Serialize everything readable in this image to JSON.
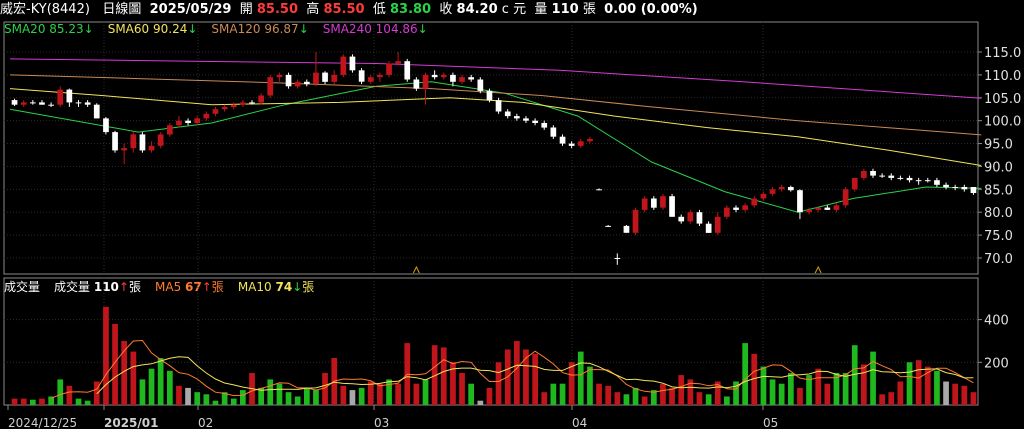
{
  "header": {
    "name": "威宏-KY(8442)",
    "period": "日線圖",
    "date": "2025/05/29",
    "open_label": "開",
    "open": "85.50",
    "high_label": "高",
    "high": "85.50",
    "low_label": "低",
    "low": "83.80",
    "close_label": "收",
    "close": "84.20",
    "close_flag": "c",
    "currency": "元",
    "vol_label": "量",
    "vol": "110",
    "vol_unit": "張",
    "change": "0.00 (0.00%)"
  },
  "price_legend": [
    {
      "label": "SMA20",
      "value": "85.23",
      "arrow": "↓",
      "color": "#29d34a"
    },
    {
      "label": "SMA60",
      "value": "90.24",
      "arrow": "↓",
      "color": "#f2e35a"
    },
    {
      "label": "SMA120",
      "value": "96.87",
      "arrow": "↓",
      "color": "#c98a55"
    },
    {
      "label": "SMA240",
      "value": "104.86",
      "arrow": "↓",
      "color": "#d33bd3"
    }
  ],
  "volume_legend": {
    "title": "成交量",
    "items": [
      {
        "label": "成交量",
        "value": "110",
        "arrow": "↑",
        "unit": "張",
        "label_color": "#ffffff",
        "value_color": "#ffffff",
        "arrow_color": "#ff3b3b"
      },
      {
        "label": "MA5",
        "value": "67",
        "arrow": "↑",
        "unit": "張",
        "label_color": "#ff7b2e",
        "value_color": "#ff7b2e",
        "arrow_color": "#ff3b3b"
      },
      {
        "label": "MA10",
        "value": "74",
        "arrow": "↓",
        "unit": "張",
        "label_color": "#f2e35a",
        "value_color": "#f2e35a",
        "arrow_color": "#29d34a"
      }
    ]
  },
  "colors": {
    "up": "#c0161b",
    "down": "#ffffff",
    "vol_up": "#c0161b",
    "vol_down": "#1fb81f",
    "vol_flat": "#a9a9a9",
    "grid": "#2a2a2a",
    "frame": "#8a8a8a",
    "marker": "#d8a000"
  },
  "chart_data": [
    {
      "type": "candlestick",
      "x_labels": [
        "2024/12/25",
        "2025/01",
        "02",
        "03",
        "04",
        "05"
      ],
      "y_ticks": [
        70.0,
        75.0,
        80.0,
        85.0,
        90.0,
        95.0,
        100.0,
        105.0,
        110.0,
        115.0
      ],
      "ylim": [
        66.5,
        118.5
      ],
      "candles": [
        [
          104.5,
          104.8,
          103.2,
          103.5
        ],
        [
          103.5,
          104.5,
          103.0,
          104.0
        ],
        [
          104.0,
          104.5,
          103.5,
          104.0
        ],
        [
          104.0,
          104.5,
          103.5,
          103.5
        ],
        [
          103.5,
          104.0,
          103.0,
          103.5
        ],
        [
          103.5,
          107.5,
          103.0,
          106.8
        ],
        [
          106.8,
          107.0,
          103.0,
          104.0
        ],
        [
          104.0,
          104.5,
          103.0,
          104.0
        ],
        [
          104.0,
          104.5,
          103.0,
          103.5
        ],
        [
          103.5,
          103.8,
          100.5,
          100.5
        ],
        [
          100.5,
          100.8,
          97.0,
          97.5
        ],
        [
          97.5,
          97.8,
          93.0,
          93.5
        ],
        [
          93.5,
          95.0,
          90.5,
          94.0
        ],
        [
          94.0,
          97.5,
          93.0,
          97.0
        ],
        [
          97.0,
          97.5,
          93.0,
          93.5
        ],
        [
          93.5,
          95.5,
          93.0,
          94.5
        ],
        [
          94.5,
          97.5,
          94.0,
          97.0
        ],
        [
          97.0,
          99.5,
          96.5,
          99.0
        ],
        [
          99.0,
          101.0,
          98.5,
          100.0
        ],
        [
          100.0,
          100.5,
          99.0,
          99.5
        ],
        [
          99.5,
          101.0,
          99.0,
          100.5
        ],
        [
          100.5,
          102.0,
          100.0,
          101.5
        ],
        [
          101.5,
          103.0,
          101.0,
          102.5
        ],
        [
          102.5,
          103.5,
          102.0,
          103.0
        ],
        [
          103.0,
          104.0,
          102.5,
          103.5
        ],
        [
          103.5,
          104.5,
          103.0,
          104.0
        ],
        [
          104.0,
          104.5,
          103.5,
          104.0
        ],
        [
          104.0,
          106.0,
          103.5,
          105.5
        ],
        [
          105.5,
          110.0,
          105.0,
          109.5
        ],
        [
          109.5,
          110.5,
          108.5,
          110.0
        ],
        [
          110.0,
          110.5,
          107.0,
          107.5
        ],
        [
          107.5,
          109.0,
          107.0,
          108.5
        ],
        [
          108.5,
          109.0,
          107.5,
          108.0
        ],
        [
          108.0,
          115.0,
          107.5,
          110.5
        ],
        [
          110.5,
          110.8,
          108.0,
          108.5
        ],
        [
          108.5,
          111.0,
          108.0,
          110.0
        ],
        [
          110.0,
          114.5,
          109.5,
          114.0
        ],
        [
          114.0,
          114.5,
          110.5,
          111.0
        ],
        [
          111.0,
          111.5,
          108.0,
          108.5
        ],
        [
          108.5,
          110.0,
          108.0,
          109.5
        ],
        [
          109.5,
          110.5,
          108.5,
          110.0
        ],
        [
          110.0,
          113.0,
          109.5,
          112.5
        ],
        [
          112.5,
          115.0,
          112.0,
          113.0
        ],
        [
          113.0,
          113.5,
          108.5,
          109.0
        ],
        [
          109.0,
          109.5,
          106.5,
          107.0
        ],
        [
          107.0,
          110.5,
          103.5,
          110.0
        ],
        [
          110.0,
          111.0,
          109.0,
          109.5
        ],
        [
          109.5,
          110.5,
          109.0,
          110.0
        ],
        [
          110.0,
          110.5,
          107.5,
          108.5
        ],
        [
          108.5,
          110.0,
          108.0,
          109.5
        ],
        [
          109.5,
          110.0,
          108.5,
          109.0
        ],
        [
          109.0,
          109.5,
          106.0,
          106.5
        ],
        [
          106.5,
          107.0,
          104.0,
          104.5
        ],
        [
          104.5,
          105.0,
          101.5,
          102.0
        ],
        [
          102.0,
          102.5,
          100.5,
          101.0
        ],
        [
          101.0,
          101.5,
          100.0,
          100.5
        ],
        [
          100.5,
          101.0,
          99.5,
          100.0
        ],
        [
          100.0,
          100.5,
          99.0,
          99.5
        ],
        [
          99.5,
          100.0,
          98.0,
          98.5
        ],
        [
          98.5,
          99.0,
          96.0,
          96.5
        ],
        [
          96.5,
          97.0,
          94.5,
          95.0
        ],
        [
          95.0,
          95.5,
          94.0,
          94.5
        ],
        [
          94.5,
          96.0,
          94.0,
          95.5
        ],
        [
          95.5,
          96.5,
          95.0,
          96.0
        ],
        [
          85.0,
          85.2,
          84.8,
          85.0
        ],
        [
          77.0,
          77.2,
          76.8,
          77.0
        ],
        [
          70.0,
          71.0,
          68.5,
          70.0
        ],
        [
          77.0,
          77.2,
          75.5,
          75.5
        ],
        [
          75.5,
          81.0,
          75.0,
          80.5
        ],
        [
          80.5,
          83.5,
          80.0,
          83.0
        ],
        [
          83.0,
          83.5,
          80.5,
          81.0
        ],
        [
          81.0,
          84.0,
          80.5,
          83.5
        ],
        [
          83.5,
          84.0,
          79.0,
          79.0
        ],
        [
          79.0,
          79.5,
          77.5,
          78.0
        ],
        [
          78.0,
          80.5,
          77.5,
          80.0
        ],
        [
          80.0,
          80.5,
          77.0,
          77.5
        ],
        [
          77.5,
          78.0,
          75.5,
          75.5
        ],
        [
          75.5,
          80.0,
          75.0,
          79.0
        ],
        [
          79.0,
          81.5,
          78.5,
          81.0
        ],
        [
          81.0,
          81.5,
          80.0,
          80.5
        ],
        [
          80.5,
          82.0,
          80.0,
          81.5
        ],
        [
          81.5,
          83.5,
          81.0,
          83.0
        ],
        [
          83.0,
          84.5,
          82.5,
          84.0
        ],
        [
          84.0,
          85.5,
          83.5,
          85.0
        ],
        [
          85.0,
          86.0,
          84.5,
          85.5
        ],
        [
          85.5,
          85.8,
          84.5,
          84.8
        ],
        [
          84.8,
          85.0,
          78.5,
          80.0
        ],
        [
          80.0,
          81.0,
          79.5,
          80.5
        ],
        [
          80.5,
          81.0,
          80.0,
          81.0
        ],
        [
          81.0,
          81.5,
          80.5,
          80.5
        ],
        [
          80.5,
          82.0,
          80.0,
          81.5
        ],
        [
          81.5,
          85.5,
          81.0,
          85.0
        ],
        [
          85.0,
          87.5,
          84.5,
          87.5
        ],
        [
          87.5,
          89.5,
          87.0,
          89.0
        ],
        [
          89.0,
          89.5,
          87.5,
          88.0
        ],
        [
          88.0,
          88.5,
          87.5,
          88.0
        ],
        [
          88.0,
          88.5,
          87.0,
          87.5
        ],
        [
          87.5,
          88.0,
          87.0,
          87.5
        ],
        [
          87.5,
          88.0,
          86.5,
          87.0
        ],
        [
          87.0,
          87.5,
          86.0,
          87.0
        ],
        [
          87.0,
          87.5,
          86.5,
          87.0
        ],
        [
          87.0,
          87.5,
          85.5,
          86.0
        ],
        [
          86.0,
          86.5,
          85.0,
          85.5
        ],
        [
          85.5,
          86.0,
          84.8,
          85.5
        ],
        [
          85.5,
          86.0,
          84.5,
          85.0
        ],
        [
          85.5,
          85.5,
          83.8,
          84.2
        ]
      ],
      "series": [
        {
          "name": "SMA20",
          "color": "#29d34a",
          "values": [
            [
              0,
              102.5
            ],
            [
              14,
              97.5
            ],
            [
              22,
              99.5
            ],
            [
              30,
              103.5
            ],
            [
              40,
              107.5
            ],
            [
              46,
              108.5
            ],
            [
              54,
              106.0
            ],
            [
              62,
              101.0
            ],
            [
              70,
              91.0
            ],
            [
              78,
              84.5
            ],
            [
              86,
              80.0
            ],
            [
              92,
              83.0
            ],
            [
              100,
              85.5
            ],
            [
              106,
              85.2
            ]
          ]
        },
        {
          "name": "SMA60",
          "color": "#f2e35a",
          "values": [
            [
              0,
              107.0
            ],
            [
              10,
              105.5
            ],
            [
              22,
              103.5
            ],
            [
              36,
              104.0
            ],
            [
              48,
              105.0
            ],
            [
              56,
              104.0
            ],
            [
              66,
              101.0
            ],
            [
              76,
              98.5
            ],
            [
              86,
              96.5
            ],
            [
              96,
              93.5
            ],
            [
              106,
              90.2
            ]
          ]
        },
        {
          "name": "SMA120",
          "color": "#c98a55",
          "values": [
            [
              0,
              110.0
            ],
            [
              14,
              109.2
            ],
            [
              30,
              108.2
            ],
            [
              46,
              107.0
            ],
            [
              58,
              105.5
            ],
            [
              70,
              103.0
            ],
            [
              86,
              100.0
            ],
            [
              106,
              96.9
            ]
          ]
        },
        {
          "name": "SMA240",
          "color": "#d33bd3",
          "values": [
            [
              0,
              113.5
            ],
            [
              20,
              113.0
            ],
            [
              40,
              112.5
            ],
            [
              60,
              111.0
            ],
            [
              80,
              108.5
            ],
            [
              106,
              104.9
            ]
          ]
        }
      ],
      "markers": [
        [
          44,
          66.5
        ],
        [
          88,
          66.5
        ]
      ]
    },
    {
      "type": "bar",
      "y_ticks": [
        200,
        400
      ],
      "ylim": [
        0,
        520
      ],
      "volumes": [
        30,
        30,
        25,
        30,
        40,
        120,
        90,
        30,
        20,
        110,
        460,
        380,
        300,
        250,
        120,
        170,
        220,
        160,
        90,
        80,
        60,
        50,
        20,
        60,
        30,
        70,
        150,
        80,
        120,
        100,
        60,
        40,
        80,
        70,
        150,
        220,
        90,
        70,
        80,
        110,
        100,
        120,
        100,
        290,
        100,
        120,
        280,
        270,
        200,
        150,
        100,
        20,
        80,
        200,
        260,
        300,
        260,
        240,
        60,
        100,
        100,
        200,
        250,
        180,
        100,
        90,
        60,
        50,
        80,
        40,
        70,
        100,
        80,
        140,
        120,
        60,
        50,
        110,
        40,
        110,
        290,
        240,
        180,
        120,
        100,
        150,
        80,
        140,
        170,
        100,
        150,
        150,
        280,
        190,
        250,
        50,
        60,
        110,
        200,
        210,
        180,
        160,
        110,
        100,
        90,
        60,
        50,
        110
      ],
      "directions": [
        0,
        0,
        1,
        0,
        1,
        1,
        0,
        1,
        1,
        0,
        0,
        0,
        0,
        0,
        1,
        1,
        1,
        1,
        0,
        2,
        1,
        1,
        1,
        1,
        1,
        1,
        0,
        1,
        1,
        1,
        1,
        1,
        1,
        1,
        0,
        0,
        0,
        2,
        1,
        0,
        0,
        1,
        0,
        0,
        0,
        1,
        0,
        0,
        0,
        0,
        1,
        2,
        0,
        0,
        0,
        0,
        0,
        0,
        0,
        1,
        1,
        0,
        1,
        1,
        0,
        0,
        0,
        1,
        1,
        0,
        1,
        0,
        0,
        0,
        0,
        0,
        1,
        0,
        1,
        1,
        1,
        0,
        1,
        1,
        1,
        1,
        0,
        1,
        0,
        0,
        1,
        1,
        1,
        0,
        1,
        0,
        0,
        0,
        1,
        0,
        0,
        1,
        2,
        0,
        0,
        0,
        0,
        2
      ],
      "series": [
        {
          "name": "MA5",
          "color": "#ff7b2e"
        },
        {
          "name": "MA10",
          "color": "#f2e35a"
        }
      ]
    }
  ]
}
